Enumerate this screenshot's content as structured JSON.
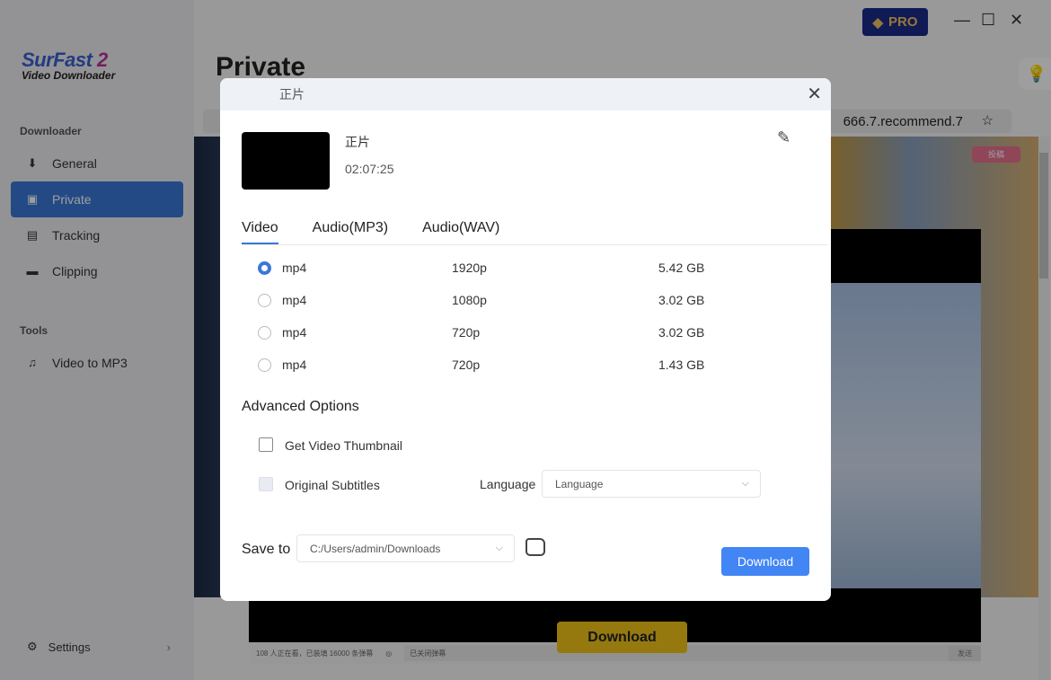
{
  "app": {
    "logo_line1": "SurFast",
    "logo_num": "2",
    "logo_line2": "Video Downloader",
    "pro_label": "PRO"
  },
  "sidebar": {
    "downloader_heading": "Downloader",
    "items": [
      {
        "label": "General",
        "icon": "download-icon"
      },
      {
        "label": "Private",
        "icon": "private-user-icon",
        "active": true
      },
      {
        "label": "Tracking",
        "icon": "tracking-icon"
      },
      {
        "label": "Clipping",
        "icon": "clip-icon"
      }
    ],
    "tools_heading": "Tools",
    "tools": [
      {
        "label": "Video to MP3",
        "icon": "music-note-icon"
      }
    ],
    "settings_label": "Settings"
  },
  "main": {
    "title": "Private",
    "url_tail": "666.7.recommend.7",
    "page_badge": "投稿",
    "stats": "108 人正在看，已装填 16000 条弹幕",
    "danmaku_placeholder": "已关闭弹幕",
    "send_label": "发送",
    "download_button": "Download"
  },
  "dialog": {
    "header_title": "正片",
    "video_title": "正片",
    "duration": "02:07:25",
    "tabs": [
      {
        "label": "Video",
        "active": true
      },
      {
        "label": "Audio(MP3)"
      },
      {
        "label": "Audio(WAV)"
      }
    ],
    "formats": [
      {
        "format": "mp4",
        "resolution": "1920p",
        "size": "5.42 GB",
        "selected": true
      },
      {
        "format": "mp4",
        "resolution": "1080p",
        "size": "3.02 GB"
      },
      {
        "format": "mp4",
        "resolution": "720p",
        "size": "3.02 GB"
      },
      {
        "format": "mp4",
        "resolution": "720p",
        "size": "1.43 GB"
      }
    ],
    "advanced_title": "Advanced Options",
    "thumbnail_label": "Get Video Thumbnail",
    "thumbnail_checked": false,
    "subtitles_label": "Original Subtitles",
    "subtitles_checked": false,
    "subtitles_disabled": true,
    "language_label": "Language",
    "language_value": "Language",
    "save_to_label": "Save to",
    "save_path": "C:/Users/admin/Downloads",
    "download_label": "Download",
    "accent": "#4285f4"
  }
}
